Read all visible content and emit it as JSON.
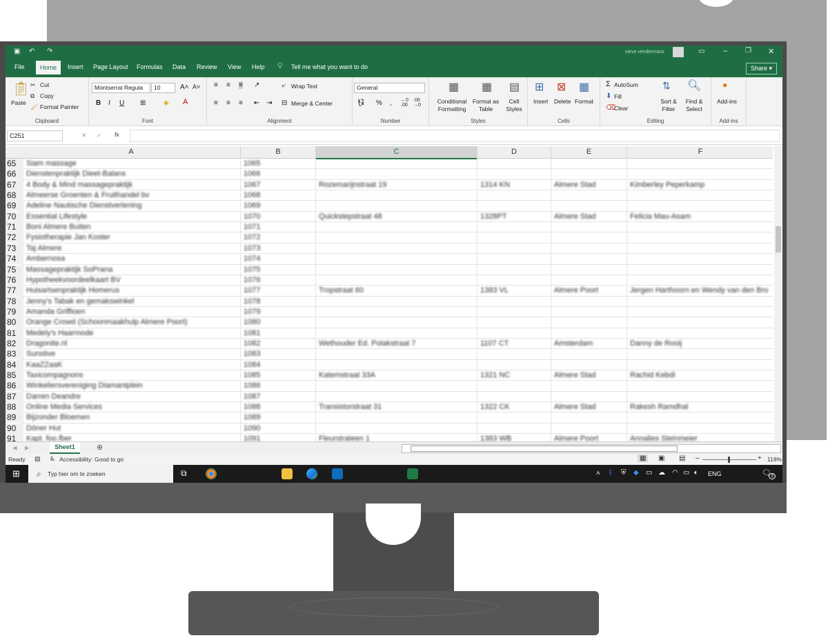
{
  "excel": {
    "title_user": "sieve vendermans",
    "tabs": [
      "File",
      "Home",
      "Insert",
      "Page Layout",
      "Formulas",
      "Data",
      "Review",
      "View",
      "Help"
    ],
    "active_tab": "Home",
    "tell_me": "Tell me what you want to do",
    "share": "Share",
    "clipboard": {
      "paste": "Paste",
      "cut": "Cut",
      "copy": "Copy",
      "format_painter": "Format Painter",
      "label": "Clipboard"
    },
    "font": {
      "name": "Montserrat Regula",
      "size": "10",
      "label": "Font"
    },
    "alignment": {
      "wrap": "Wrap Text",
      "merge": "Merge & Center",
      "label": "Alignment"
    },
    "number": {
      "format": "General",
      "label": "Number"
    },
    "styles": {
      "conditional": "Conditional Formatting",
      "format_table": "Format as Table",
      "cell_styles": "Cell Styles",
      "label": "Styles"
    },
    "cells": {
      "insert": "Insert",
      "delete": "Delete",
      "format": "Format",
      "label": "Cells"
    },
    "editing": {
      "autosum": "AutoSum",
      "fill": "Fill",
      "clear": "Clear",
      "sort": "Sort & Filter",
      "find": "Find & Select",
      "label": "Editing"
    },
    "addins": {
      "addins": "Add-ins",
      "label": "Add-ins"
    },
    "name_box": "C251",
    "fx": "fx",
    "columns": [
      "A",
      "B",
      "C",
      "D",
      "E",
      "F"
    ],
    "rows": [
      {
        "n": "65",
        "a": "Siam massage",
        "b": "1065",
        "c": "",
        "d": "",
        "e": "",
        "f": ""
      },
      {
        "n": "66",
        "a": "Dienstenpraktijk Dieet-Balans",
        "b": "1066",
        "c": "",
        "d": "",
        "e": "",
        "f": ""
      },
      {
        "n": "67",
        "a": "4 Body & Mind massagepraktijk",
        "b": "1067",
        "c": "Rozemarijnstraat 19",
        "d": "1314 KN",
        "e": "Almere Stad",
        "f": "Kimberley Peperkamp"
      },
      {
        "n": "68",
        "a": "Almeerse Groenten & Fruithandel bv",
        "b": "1068",
        "c": "",
        "d": "",
        "e": "",
        "f": ""
      },
      {
        "n": "69",
        "a": "Adeline Nautische Dienstverlening",
        "b": "1069",
        "c": "",
        "d": "",
        "e": "",
        "f": ""
      },
      {
        "n": "70",
        "a": "Essential Lifestyle",
        "b": "1070",
        "c": "Quickstepstraat 48",
        "d": "1328PT",
        "e": "Almere Stad",
        "f": "Felicia Mau-Asam"
      },
      {
        "n": "71",
        "a": "Boni Almere Buiten",
        "b": "1071",
        "c": "",
        "d": "",
        "e": "",
        "f": ""
      },
      {
        "n": "72",
        "a": "Fysiotherapie Jan Koster",
        "b": "1072",
        "c": "",
        "d": "",
        "e": "",
        "f": ""
      },
      {
        "n": "73",
        "a": "Taj Almere",
        "b": "1073",
        "c": "",
        "d": "",
        "e": "",
        "f": ""
      },
      {
        "n": "74",
        "a": "Ambernosa",
        "b": "1074",
        "c": "",
        "d": "",
        "e": "",
        "f": ""
      },
      {
        "n": "75",
        "a": "Massagepraktijk SoPrana",
        "b": "1075",
        "c": "",
        "d": "",
        "e": "",
        "f": ""
      },
      {
        "n": "76",
        "a": "Hypotheekvoordeelkaart BV",
        "b": "1076",
        "c": "",
        "d": "",
        "e": "",
        "f": ""
      },
      {
        "n": "77",
        "a": "Huisartsenpraktijk Homerus",
        "b": "1077",
        "c": "Tropstraat 60",
        "d": "1383 VL",
        "e": "Almere Poort",
        "f": "Jergen Harthoorn en Wendy van den Bro"
      },
      {
        "n": "78",
        "a": "Jenny's Tabak en gemakswinkel",
        "b": "1078",
        "c": "",
        "d": "",
        "e": "",
        "f": ""
      },
      {
        "n": "79",
        "a": "Amanda Griffioen",
        "b": "1079",
        "c": "",
        "d": "",
        "e": "",
        "f": ""
      },
      {
        "n": "80",
        "a": "Orange Crowd (Schoonmaakhulp Almere Poort)",
        "b": "1080",
        "c": "",
        "d": "",
        "e": "",
        "f": ""
      },
      {
        "n": "81",
        "a": "Medely's Haarmode",
        "b": "1081",
        "c": "",
        "d": "",
        "e": "",
        "f": ""
      },
      {
        "n": "82",
        "a": "Dragonite.nl",
        "b": "1082",
        "c": "Wethouder Ed. Polakstraat 7",
        "d": "1107 CT",
        "e": "Amsterdam",
        "f": "Danny de Rooij"
      },
      {
        "n": "83",
        "a": "Sunstive",
        "b": "1083",
        "c": "",
        "d": "",
        "e": "",
        "f": ""
      },
      {
        "n": "84",
        "a": "KaaZZaaK",
        "b": "1084",
        "c": "",
        "d": "",
        "e": "",
        "f": ""
      },
      {
        "n": "85",
        "a": "Taxicompagnons",
        "b": "1085",
        "c": "Katemstraat 33A",
        "d": "1321 NC",
        "e": "Almere Stad",
        "f": "Rachid Kebdi"
      },
      {
        "n": "86",
        "a": "Winkeliersvereniging Diamantplein",
        "b": "1086",
        "c": "",
        "d": "",
        "e": "",
        "f": ""
      },
      {
        "n": "87",
        "a": "Darren Deandre",
        "b": "1087",
        "c": "",
        "d": "",
        "e": "",
        "f": ""
      },
      {
        "n": "88",
        "a": "Online Media Services",
        "b": "1088",
        "c": "Transistorstraat 31",
        "d": "1322 CK",
        "e": "Almere Stad",
        "f": "Rakesh Ramdhal"
      },
      {
        "n": "89",
        "a": "Bijzonder Bloemen",
        "b": "1089",
        "c": "",
        "d": "",
        "e": "",
        "f": ""
      },
      {
        "n": "90",
        "a": "Döner Hut",
        "b": "1090",
        "c": "",
        "d": "",
        "e": "",
        "f": ""
      },
      {
        "n": "91",
        "a": "Kapt. foo.fber",
        "b": "1091",
        "c": "Fleurstrateen 1",
        "d": "1383 WB",
        "e": "Almere Poort",
        "f": "Annalies Steinmeier"
      }
    ],
    "sheet": "Sheet1",
    "status_ready": "Ready",
    "accessibility": "Accessibility: Good to go",
    "zoom": "118%"
  },
  "taskbar": {
    "search_placeholder": "Typ hier om te zoeken",
    "lang": "ENG",
    "notifications": "3"
  },
  "colors": {
    "excel_green": "#1f6e43",
    "privacy_filter": "#a3a3a3",
    "bezel": "#4a4a4a"
  }
}
